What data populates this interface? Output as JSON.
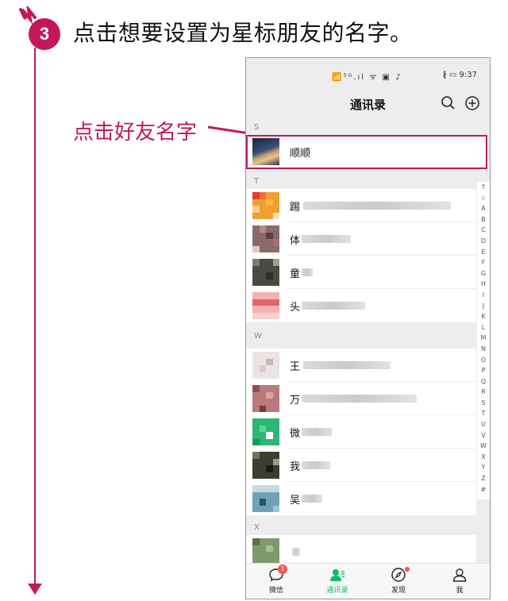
{
  "step": {
    "number": "3",
    "instruction": "点击想要设置为星标朋友的名字。"
  },
  "callout": {
    "text": "点击好友名字",
    "color": "#c2185b"
  },
  "statusbar": {
    "left_icons": "📶⁵ᴳ.ıl ᯤ ▣ ♪",
    "right_text": "∦ ▭ 9:37",
    "time": "9:37"
  },
  "navbar": {
    "title": "通讯录",
    "icons": [
      "search-icon",
      "add-circle-icon"
    ]
  },
  "sections": [
    {
      "letter": "S",
      "contacts": [
        {
          "name": "顺顺",
          "highlighted": true
        }
      ]
    },
    {
      "letter": "T",
      "contacts": [
        {
          "name": "踢"
        },
        {
          "name": "体"
        },
        {
          "name": "童"
        },
        {
          "name": "头"
        }
      ]
    },
    {
      "letter": "W",
      "contacts": [
        {
          "name": "王"
        },
        {
          "name": "万"
        },
        {
          "name": "微"
        },
        {
          "name": "我"
        },
        {
          "name": "吴"
        }
      ]
    },
    {
      "letter": "X",
      "contacts": [
        {
          "name": ""
        }
      ]
    }
  ],
  "index_letters": [
    "↑",
    "☆",
    "A",
    "B",
    "C",
    "D",
    "E",
    "F",
    "G",
    "H",
    "I",
    "J",
    "K",
    "L",
    "M",
    "N",
    "O",
    "P",
    "Q",
    "R",
    "S",
    "T",
    "U",
    "V",
    "W",
    "X",
    "Y",
    "Z",
    "#"
  ],
  "tabbar": {
    "tabs": [
      {
        "label": "微信",
        "icon": "chat-bubble-icon",
        "badge": "1"
      },
      {
        "label": "通讯录",
        "icon": "contacts-icon",
        "active": true
      },
      {
        "label": "发现",
        "icon": "compass-icon",
        "dot": true
      },
      {
        "label": "我",
        "icon": "person-icon"
      }
    ]
  },
  "colors": {
    "accent": "#c2185b",
    "wechat_green": "#07c160",
    "badge_red": "#fa5151"
  }
}
